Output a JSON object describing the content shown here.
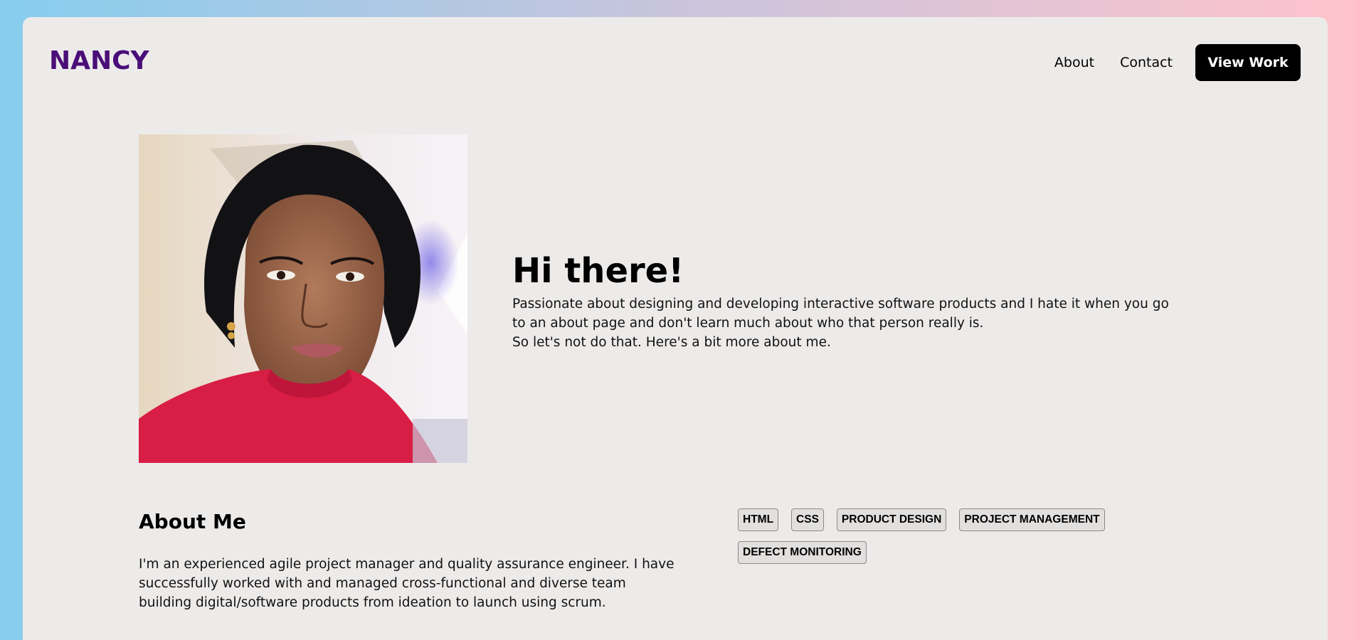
{
  "header": {
    "logo": "NANCY",
    "nav": {
      "about_label": "About",
      "contact_label": "Contact",
      "view_work_label": "View Work"
    }
  },
  "hero": {
    "title": "Hi there!",
    "paragraph_line1": "Passionate about designing and developing interactive software products and I hate it when you go to an about page and don't learn much about who that person really is.",
    "paragraph_line2": "So let's not do that. Here's a bit more about me."
  },
  "about": {
    "title": "About Me",
    "text": "I'm an experienced agile project manager and quality assurance engineer. I have successfully worked with and managed cross-functional and diverse team building digital/software products from ideation to launch using scrum."
  },
  "skills": [
    "HTML",
    "CSS",
    "PRODUCT DESIGN",
    "PROJECT MANAGEMENT",
    "DEFECT MONITORING"
  ],
  "colors": {
    "logo": "#4a0e78",
    "card_background": "#edebea",
    "button_background": "#000000",
    "gradient_left": "#87cdee",
    "gradient_right": "#fec3cc"
  }
}
